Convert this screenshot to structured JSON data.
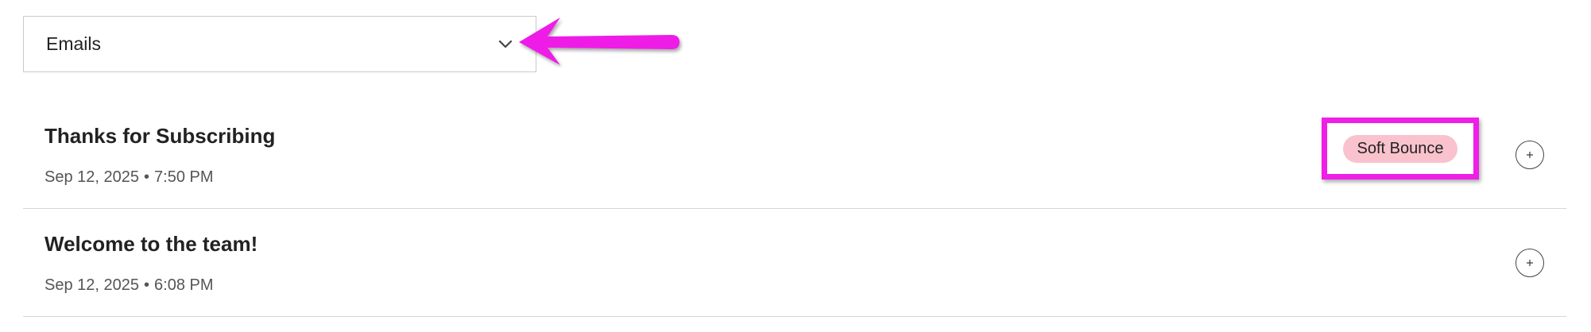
{
  "filter": {
    "selected": "Emails",
    "icon": "chevron-down-icon"
  },
  "emails": [
    {
      "title": "Thanks for Subscribing",
      "date": "Sep 12, 2025",
      "time": "7:50 PM",
      "status": "Soft Bounce",
      "status_color": "#f9c2cc"
    },
    {
      "title": "Welcome to the team!",
      "date": "Sep 12, 2025",
      "time": "6:08 PM"
    }
  ],
  "meta_separator": "•",
  "annotation": {
    "color": "#ee1fe6"
  }
}
